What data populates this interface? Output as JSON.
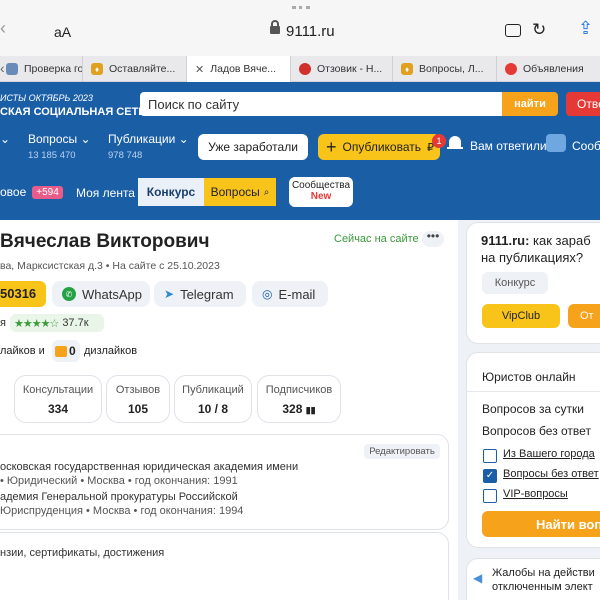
{
  "browser": {
    "text_size": "aA",
    "url": "9111.ru",
    "tabs": [
      {
        "label": "Проверка го..."
      },
      {
        "label": "Оставляйте..."
      },
      {
        "label": "Ладов Вяче..."
      },
      {
        "label": "Отзовик - Н..."
      },
      {
        "label": "Вопросы, Л..."
      },
      {
        "label": "Объявления"
      }
    ]
  },
  "header": {
    "tagline1": "ИСТЫ ОКТЯБРЬ 2023",
    "tagline2": "СКАЯ СОЦИАЛЬНАЯ СЕТЬ",
    "search_placeholder": "Поиск по сайту",
    "search_button": "найти",
    "answer_button": "Отве",
    "questions_label": "Вопросы",
    "questions_count": "13 185 470",
    "publications_label": "Публикации",
    "publications_count": "978 748",
    "earned_button": "Уже заработали",
    "publish_button": "Опубликовать",
    "publish_badge": "1",
    "answered_label": "Вам ответили",
    "messages_label": "Сообщ"
  },
  "nav": {
    "new_label": "овое",
    "new_badge": "+594",
    "feed": "Моя лента",
    "contest": "Конкурс",
    "questions": "Вопросы",
    "communities_line1": "Сообщества",
    "communities_line2": "New"
  },
  "profile": {
    "name": "Вячеслав Викторович",
    "status": "Сейчас на сайте",
    "location": "ва, Марксистская д.3 • На сайте с 25.10.2023",
    "phone_fragment": "50316",
    "whatsapp": "WhatsApp",
    "telegram": "Telegram",
    "email": "E-mail",
    "rating_prefix": "я",
    "rating_stars": "★★★★☆",
    "rating_value": "37.7к",
    "likes_text": "лайков и",
    "dislikes_count": "0",
    "dislikes_text": "дизлайков",
    "stats": [
      {
        "label": "Консультации",
        "value": "334"
      },
      {
        "label": "Отзывов",
        "value": "105"
      },
      {
        "label": "Публикаций",
        "value": "10 / 8"
      },
      {
        "label": "Подписчиков",
        "value": "328"
      }
    ],
    "edit_button": "Редактировать",
    "edu1_line1": "осковская государственная юридическая академия имени",
    "edu1_line2": "• Юридический • Москва • год окончания: 1991",
    "edu2_line1": "адемия Генеральной прокуратуры Российской",
    "edu2_line2": "Юриспруденция • Москва • год окончания: 1994",
    "licenses": "нзии, сертификаты, достижения"
  },
  "sidebar": {
    "earn_title": "9111.ru:",
    "earn_text1": " как зараб",
    "earn_text2": "на публикациях?",
    "contest_button": "Конкурс",
    "vipclub_button": "VipClub",
    "orange_button": "От",
    "lawyers_online": "Юристов онлайн",
    "q_per_day": "Вопросов за сутки",
    "q_no_answer": "Вопросов без ответ",
    "filter_city": "Из Вашего города",
    "filter_no_answer": "Вопросы без ответ",
    "filter_vip": "VIP-вопросы",
    "find_button": "Найти вопр",
    "complaints1": "Жалобы на действи",
    "complaints2": "отключенным элект"
  },
  "colors": {
    "brand_blue": "#1a5fa6",
    "accent_yellow": "#f8c41a",
    "accent_orange": "#f7a21b",
    "red": "#e53935"
  }
}
